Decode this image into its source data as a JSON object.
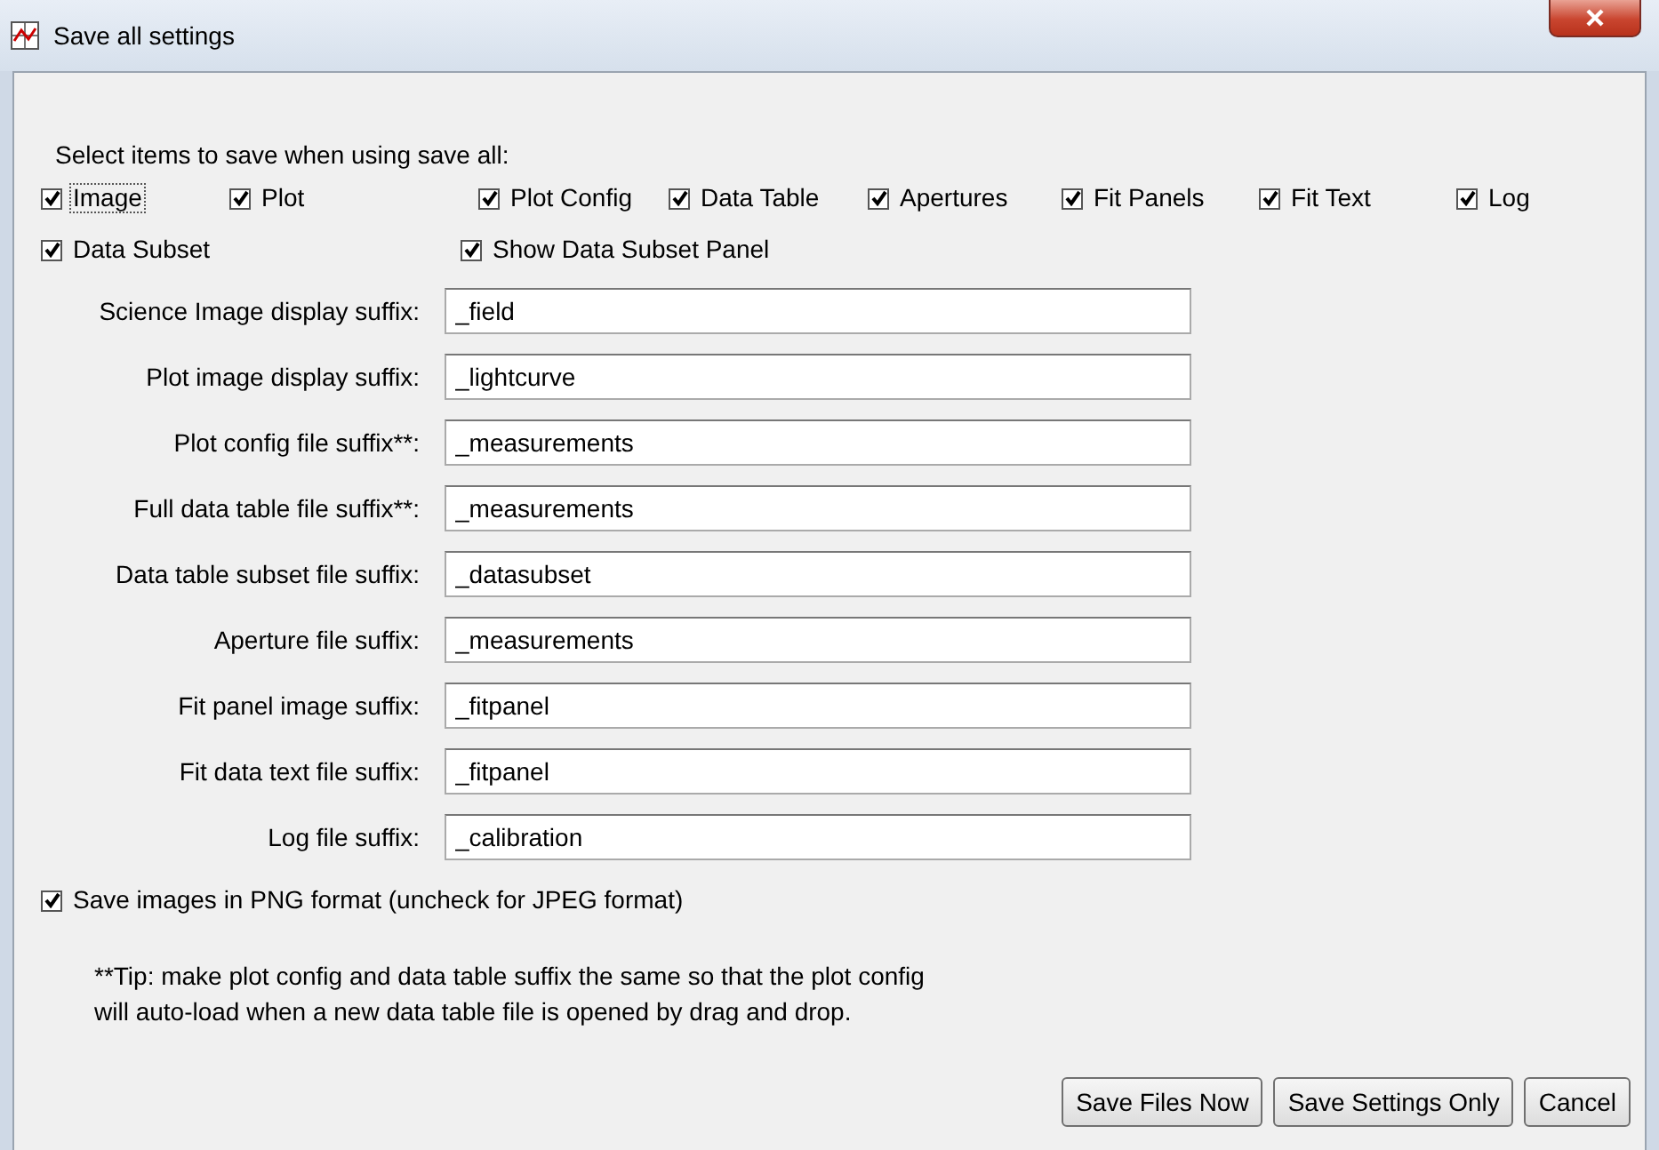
{
  "window": {
    "title": "Save all settings"
  },
  "intro": "Select items to save when using save all:",
  "item_rows": [
    [
      {
        "label": "Image",
        "checked": true,
        "focused": true
      },
      {
        "label": "Plot",
        "checked": true,
        "focused": false
      },
      {
        "label": "Plot Config",
        "checked": true,
        "focused": false
      },
      {
        "label": "Data Table",
        "checked": true,
        "focused": false
      },
      {
        "label": "Apertures",
        "checked": true,
        "focused": false
      },
      {
        "label": "Fit Panels",
        "checked": true,
        "focused": false
      },
      {
        "label": "Fit Text",
        "checked": true,
        "focused": false
      },
      {
        "label": "Log",
        "checked": true,
        "focused": false
      }
    ],
    [
      {
        "label": "Data Subset",
        "checked": true,
        "focused": false
      },
      {
        "label": "Show Data Subset Panel",
        "checked": true,
        "focused": false
      }
    ]
  ],
  "fields": [
    {
      "label": "Science Image display suffix:",
      "value": "_field"
    },
    {
      "label": "Plot image display suffix:",
      "value": "_lightcurve"
    },
    {
      "label": "Plot config file suffix**:",
      "value": "_measurements"
    },
    {
      "label": "Full data table file suffix**:",
      "value": "_measurements"
    },
    {
      "label": "Data table subset file suffix:",
      "value": "_datasubset"
    },
    {
      "label": "Aperture file suffix:",
      "value": "_measurements"
    },
    {
      "label": "Fit panel image suffix:",
      "value": "_fitpanel"
    },
    {
      "label": "Fit data text file suffix:",
      "value": "_fitpanel"
    },
    {
      "label": "Log file suffix:",
      "value": "_calibration"
    }
  ],
  "png_option": {
    "label": "Save images in PNG format (uncheck for JPEG format)",
    "checked": true
  },
  "tip": [
    "**Tip: make plot config and data table suffix the same so that the plot config",
    "will auto-load when a new data table file is opened by drag and drop."
  ],
  "buttons": [
    "Save Files Now",
    "Save Settings Only",
    "Cancel"
  ]
}
